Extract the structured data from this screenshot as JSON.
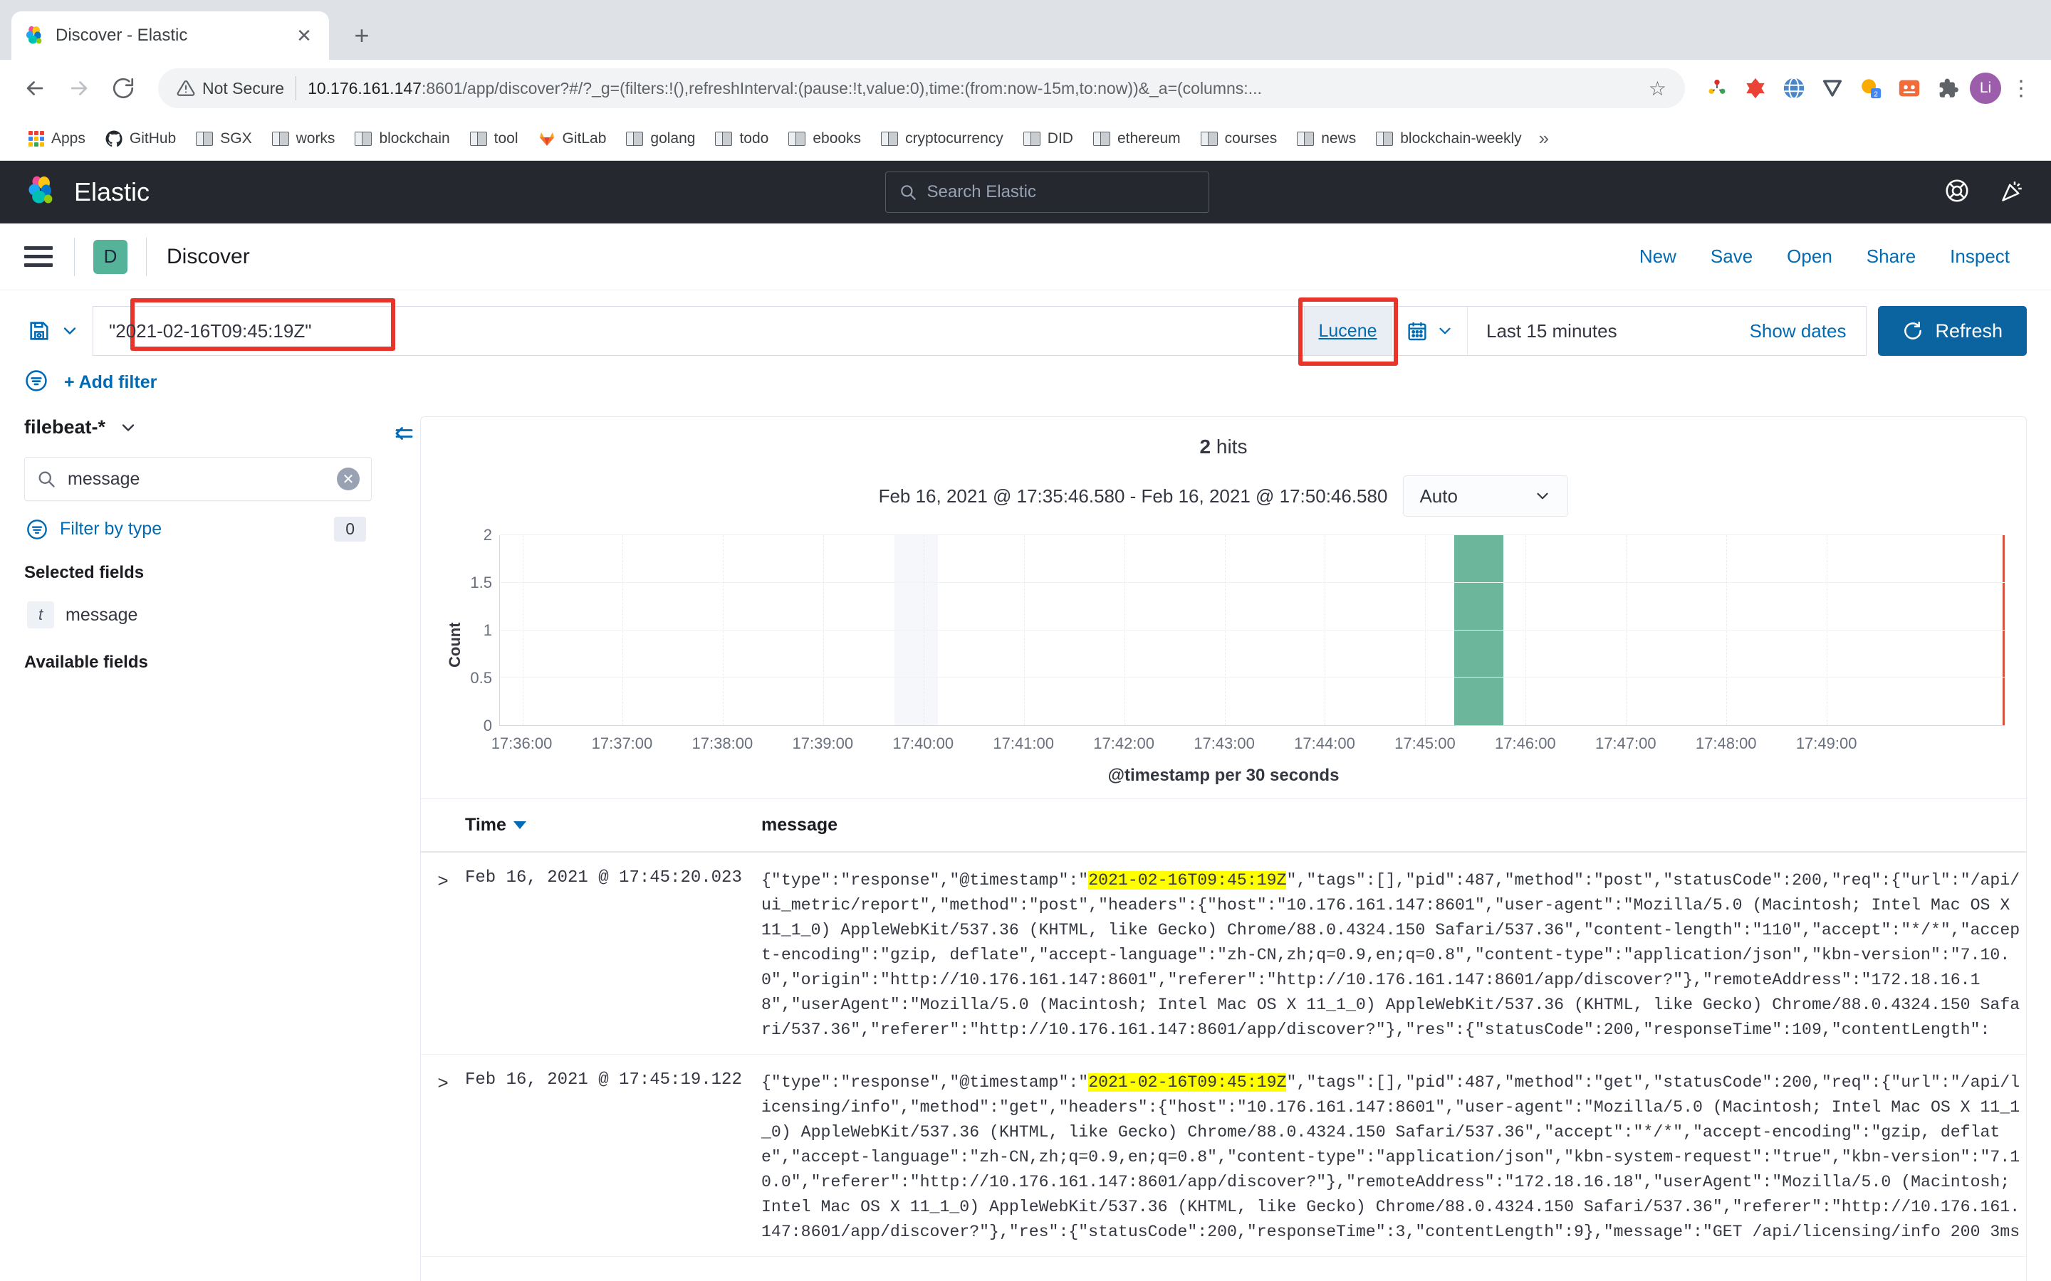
{
  "browser": {
    "tab": {
      "title": "Discover - Elastic",
      "favicon_name": "elastic-logo-icon",
      "close_label": "✕"
    },
    "newtab_label": "+",
    "nav": {
      "back": "←",
      "forward": "→",
      "reload": "↻"
    },
    "omnibox": {
      "security_label": "Not Secure",
      "url_bold": "10.176.161.147",
      "url_rest": ":8601/app/discover?#/?_g=(filters:!(),refreshInterval:(pause:!t,value:0),time:(from:now-15m,to:now))&_a=(columns:...",
      "star": "☆"
    },
    "profile_initials": "Li",
    "menu_glyph": "⋮",
    "bookmarks": [
      {
        "label": "Apps",
        "icon": "apps-grid-icon"
      },
      {
        "label": "GitHub",
        "icon": "github-icon"
      },
      {
        "label": "SGX",
        "icon": "folder-icon"
      },
      {
        "label": "works",
        "icon": "folder-icon"
      },
      {
        "label": "blockchain",
        "icon": "folder-icon"
      },
      {
        "label": "tool",
        "icon": "folder-icon"
      },
      {
        "label": "GitLab",
        "icon": "gitlab-icon"
      },
      {
        "label": "golang",
        "icon": "folder-icon"
      },
      {
        "label": "todo",
        "icon": "folder-icon"
      },
      {
        "label": "ebooks",
        "icon": "folder-icon"
      },
      {
        "label": "cryptocurrency",
        "icon": "folder-icon"
      },
      {
        "label": "DID",
        "icon": "folder-icon"
      },
      {
        "label": "ethereum",
        "icon": "folder-icon"
      },
      {
        "label": "courses",
        "icon": "folder-icon"
      },
      {
        "label": "news",
        "icon": "folder-icon"
      },
      {
        "label": "blockchain-weekly",
        "icon": "folder-icon"
      }
    ],
    "bookmarks_overflow": "»"
  },
  "kibana": {
    "brand": "Elastic",
    "search_placeholder": "Search Elastic",
    "header_icons": [
      "help-icon",
      "news-feed-icon"
    ],
    "app_badge": "D",
    "app_title": "Discover",
    "nav_actions": [
      "New",
      "Save",
      "Open",
      "Share",
      "Inspect"
    ]
  },
  "query": {
    "saved_query_icon": "save-query-icon",
    "value": "\"2021-02-16T09:45:19Z\"",
    "language": "Lucene",
    "calendar_icon": "calendar-icon",
    "time_range": "Last 15 minutes",
    "show_dates": "Show dates",
    "refresh_label": "Refresh"
  },
  "filters": {
    "filter_icon": "filter-icon",
    "dash": "—",
    "add_filter": "+ Add filter"
  },
  "sidebar": {
    "index_pattern": "filebeat-*",
    "field_search_value": "message",
    "filter_by_type": "Filter by type",
    "filter_by_type_count": "0",
    "selected_fields_title": "Selected fields",
    "selected_fields": [
      {
        "name": "message",
        "type": "t"
      }
    ],
    "available_fields_title": "Available fields",
    "collapse_icon": "collapse-sidebar-icon"
  },
  "results": {
    "hits_count": "2",
    "hits_label": "hits",
    "range_label": "Feb 16, 2021 @ 17:35:46.580 - Feb 16, 2021 @ 17:50:46.580",
    "interval": "Auto",
    "columns": {
      "time": "Time",
      "message": "message"
    },
    "rows": [
      {
        "time": "Feb 16, 2021 @ 17:45:20.023",
        "msg_pre": "{\"type\":\"response\",\"@timestamp\":\"",
        "msg_hl": "2021-02-16T09:45:19Z",
        "msg_post": "\",\"tags\":[],\"pid\":487,\"method\":\"post\",\"statusCode\":200,\"req\":{\"url\":\"/api/ui_metric/report\",\"method\":\"post\",\"headers\":{\"host\":\"10.176.161.147:8601\",\"user-agent\":\"Mozilla/5.0 (Macintosh; Intel Mac OS X 11_1_0) AppleWebKit/537.36 (KHTML, like Gecko) Chrome/88.0.4324.150 Safari/537.36\",\"content-length\":\"110\",\"accept\":\"*/*\",\"accept-encoding\":\"gzip, deflate\",\"accept-language\":\"zh-CN,zh;q=0.9,en;q=0.8\",\"content-type\":\"application/json\",\"kbn-version\":\"7.10.0\",\"origin\":\"http://10.176.161.147:8601\",\"referer\":\"http://10.176.161.147:8601/app/discover?\"},\"remoteAddress\":\"172.18.16.18\",\"userAgent\":\"Mozilla/5.0 (Macintosh; Intel Mac OS X 11_1_0) AppleWebKit/537.36 (KHTML, like Gecko) Chrome/88.0.4324.150 Safari/537.36\",\"referer\":\"http://10.176.161.147:8601/app/discover?\"},\"res\":{\"statusCode\":200,\"responseTime\":109,\"contentLength\":"
      },
      {
        "time": "Feb 16, 2021 @ 17:45:19.122",
        "msg_pre": "{\"type\":\"response\",\"@timestamp\":\"",
        "msg_hl": "2021-02-16T09:45:19Z",
        "msg_post": "\",\"tags\":[],\"pid\":487,\"method\":\"get\",\"statusCode\":200,\"req\":{\"url\":\"/api/licensing/info\",\"method\":\"get\",\"headers\":{\"host\":\"10.176.161.147:8601\",\"user-agent\":\"Mozilla/5.0 (Macintosh; Intel Mac OS X 11_1_0) AppleWebKit/537.36 (KHTML, like Gecko) Chrome/88.0.4324.150 Safari/537.36\",\"accept\":\"*/*\",\"accept-encoding\":\"gzip, deflate\",\"accept-language\":\"zh-CN,zh;q=0.9,en;q=0.8\",\"content-type\":\"application/json\",\"kbn-system-request\":\"true\",\"kbn-version\":\"7.10.0\",\"referer\":\"http://10.176.161.147:8601/app/discover?\"},\"remoteAddress\":\"172.18.16.18\",\"userAgent\":\"Mozilla/5.0 (Macintosh; Intel Mac OS X 11_1_0) AppleWebKit/537.36 (KHTML, like Gecko) Chrome/88.0.4324.150 Safari/537.36\",\"referer\":\"http://10.176.161.147:8601/app/discover?\"},\"res\":{\"statusCode\":200,\"responseTime\":3,\"contentLength\":9},\"message\":\"GET /api/licensing/info 200 3ms"
      }
    ]
  },
  "chart_data": {
    "type": "bar",
    "title": "",
    "xlabel": "@timestamp per 30 seconds",
    "ylabel": "Count",
    "ylim": [
      0,
      2
    ],
    "yticks": [
      0,
      0.5,
      1,
      1.5,
      2
    ],
    "ytick_labels": [
      "0",
      "0.5",
      "1",
      "1.5",
      "2"
    ],
    "xtick_labels": [
      "17:36:00",
      "17:37:00",
      "17:38:00",
      "17:39:00",
      "17:40:00",
      "17:41:00",
      "17:42:00",
      "17:43:00",
      "17:44:00",
      "17:45:00",
      "17:46:00",
      "17:47:00",
      "17:48:00",
      "17:49:00"
    ],
    "x_start": "17:35:46.580",
    "x_end": "17:50:46.580",
    "bar_color": "#6cb69c",
    "now_marker_color": "#d4543f",
    "categories": [
      "17:45:00"
    ],
    "values": [
      2
    ],
    "grid": true,
    "legend": "none"
  }
}
